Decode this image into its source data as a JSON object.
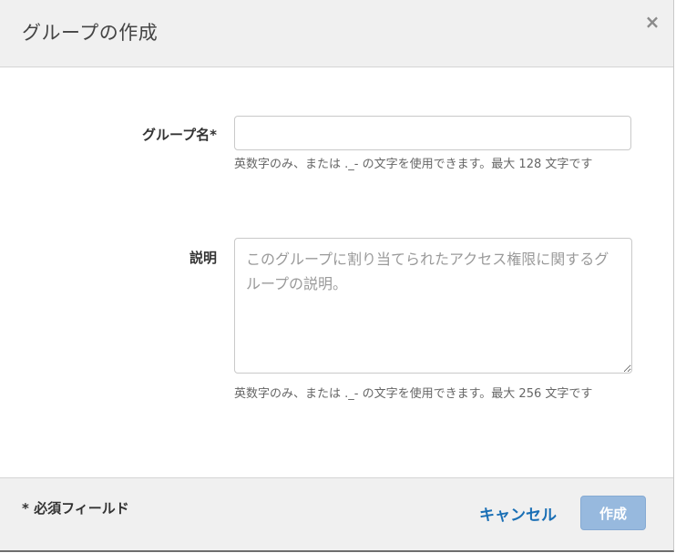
{
  "dialog": {
    "title": "グループの作成",
    "close_icon": "×"
  },
  "form": {
    "name_label": "グループ名*",
    "name_value": "",
    "name_hint": "英数字のみ、または ._- の文字を使用できます。最大 128 文字です",
    "description_label": "説明",
    "description_placeholder": "このグループに割り当てられたアクセス権限に関するグループの説明。",
    "description_hint": "英数字のみ、または ._- の文字を使用できます。最大 256 文字です"
  },
  "footer": {
    "required_note": "* 必須フィールド",
    "cancel_label": "キャンセル",
    "create_label": "作成"
  },
  "colors": {
    "accent_link": "#1a6fb5",
    "primary_button_disabled": "#97b9de",
    "header_bg": "#f0f0f0"
  }
}
